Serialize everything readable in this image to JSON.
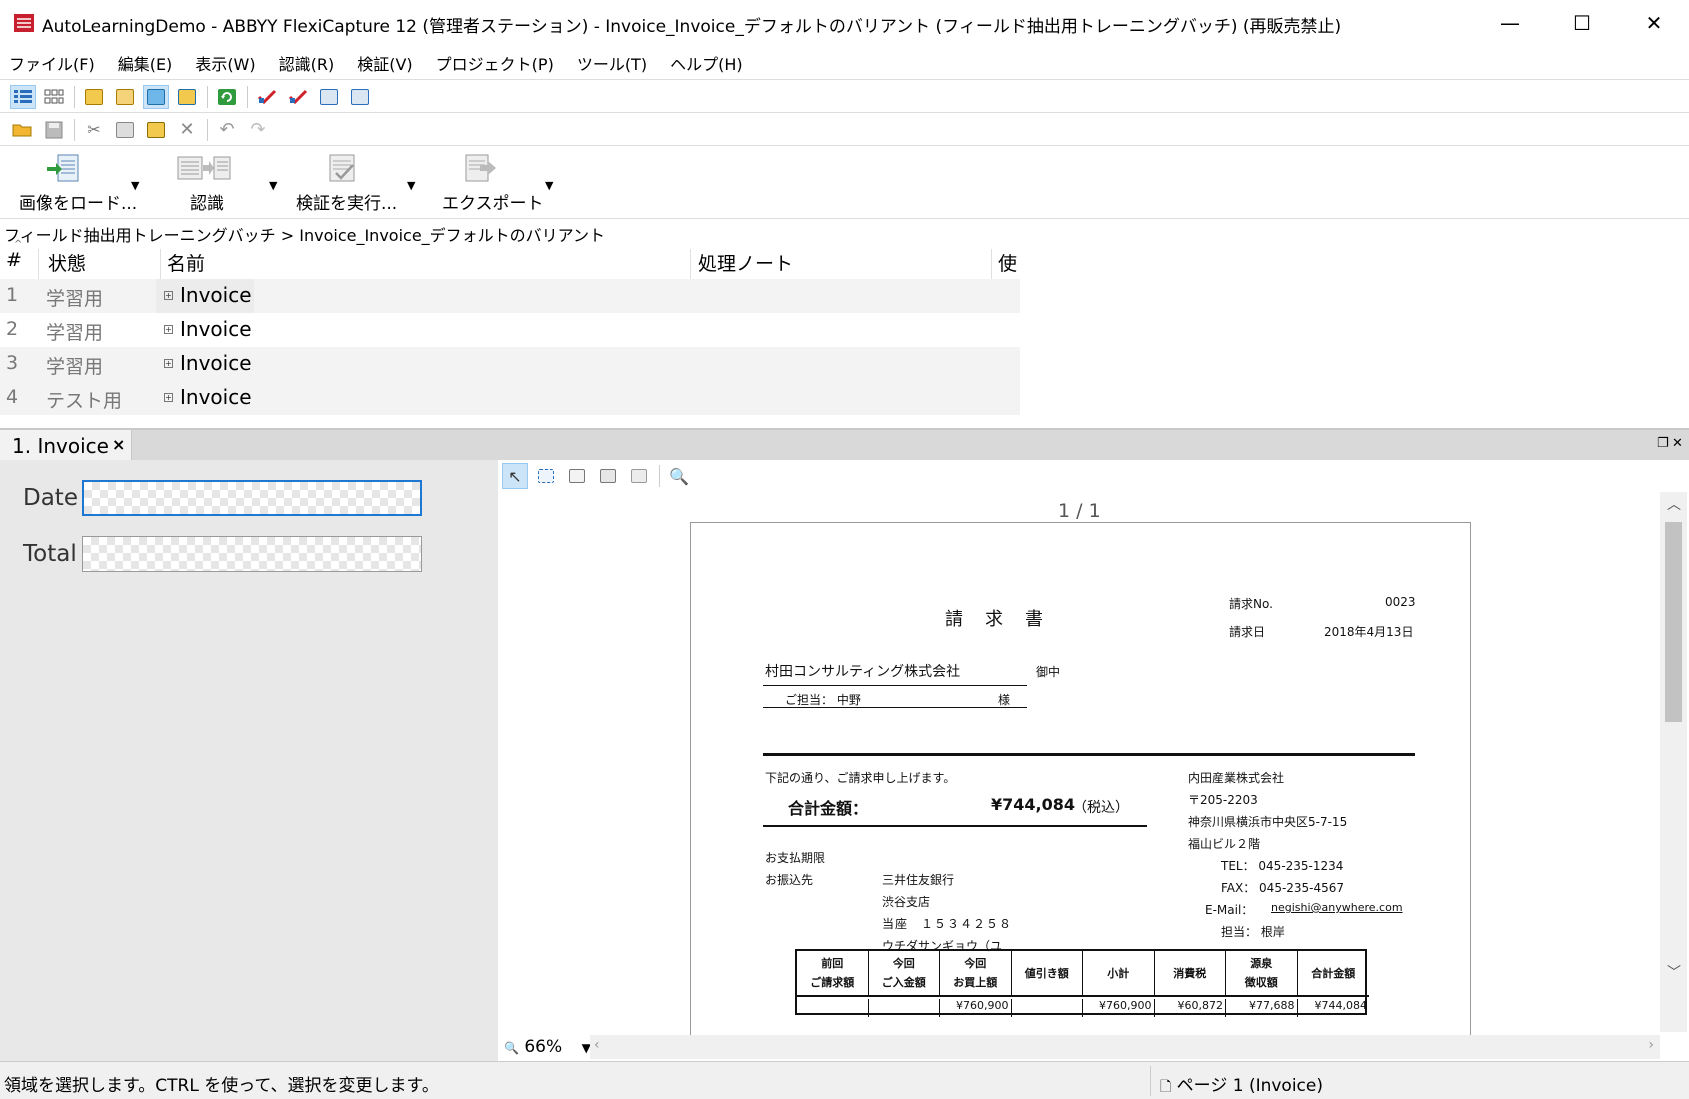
{
  "window": {
    "title": "AutoLearningDemo - ABBYY FlexiCapture 12 (管理者ステーション) - Invoice_Invoice_デフォルトのバリアント (フィールド抽出用トレーニングバッチ) (再販売禁止)",
    "minimize": "—",
    "maximize": "☐",
    "close": "✕"
  },
  "menu": [
    "ファイル(F)",
    "編集(E)",
    "表示(W)",
    "認識(R)",
    "検証(V)",
    "プロジェクト(P)",
    "ツール(T)",
    "ヘルプ(H)"
  ],
  "big_toolbar": {
    "load": "画像をロード...",
    "recognize": "認識",
    "verify": "検証を実行...",
    "export": "エクスポート",
    "dropdown": "▼"
  },
  "breadcrumb": "フィールド抽出用トレーニングバッチ  >  Invoice_Invoice_デフォルトのバリアント",
  "doclist": {
    "columns": [
      "#",
      "状態",
      "名前",
      "処理ノート",
      "使"
    ],
    "rows": [
      {
        "num": "1",
        "state": "学習用",
        "name": "Invoice"
      },
      {
        "num": "2",
        "state": "学習用",
        "name": "Invoice"
      },
      {
        "num": "3",
        "state": "学習用",
        "name": "Invoice"
      },
      {
        "num": "4",
        "state": "テスト用",
        "name": "Invoice"
      }
    ]
  },
  "doc_tab": {
    "label": "1. Invoice",
    "close": "×"
  },
  "fields": {
    "date_label": "Date",
    "total_label": "Total"
  },
  "viewer": {
    "page_count": "1 / 1",
    "zoom": "66%"
  },
  "invoice": {
    "title": "請　求　書",
    "no_label": "請求No.",
    "no_value": "0023",
    "date_label": "請求日",
    "date_value": "2018年4月13日",
    "customer": "村田コンサルティング株式会社",
    "onchu": "御中",
    "contact": "ご担当：  中野",
    "sama": "様",
    "intro": "下記の通り、ご請求申し上げます。",
    "total_label": "合計金額：",
    "total_value": "¥744,084",
    "tax_note": "（税込）",
    "pay_deadline": "お支払期限",
    "transfer": "お振込先",
    "bank": "三井住友銀行",
    "branch": "渋谷支店",
    "account": "当座　１５３４２５８",
    "account_name": "ウチダサンギョウ（ユ",
    "vendor": "内田産業株式会社",
    "zip": "〒205-2203",
    "address1": "神奈川県横浜市中央区5-7-15",
    "address2": "福山ビル２階",
    "tel": "TEL：  045-235-1234",
    "fax": "FAX：  045-235-4567",
    "email_label": "E-Mail：",
    "email": "negishi@anywhere.com",
    "rep": "担当：  根岸",
    "table_headers": [
      [
        "前回",
        "ご請求額"
      ],
      [
        "今回",
        "ご入金額"
      ],
      [
        "今回",
        "お買上額"
      ],
      [
        "値引き額"
      ],
      [
        "小計"
      ],
      [
        "消費税"
      ],
      [
        "源泉",
        "徴収額"
      ],
      [
        "合計金額"
      ]
    ],
    "table_row_partial": [
      "",
      "",
      "¥760,900",
      "",
      "¥760,900",
      "¥60,872",
      "¥77,688",
      "¥744,084"
    ]
  },
  "status": {
    "message": "領域を選択します。CTRL を使って、選択を変更します。",
    "page": "ページ 1 (Invoice)"
  }
}
